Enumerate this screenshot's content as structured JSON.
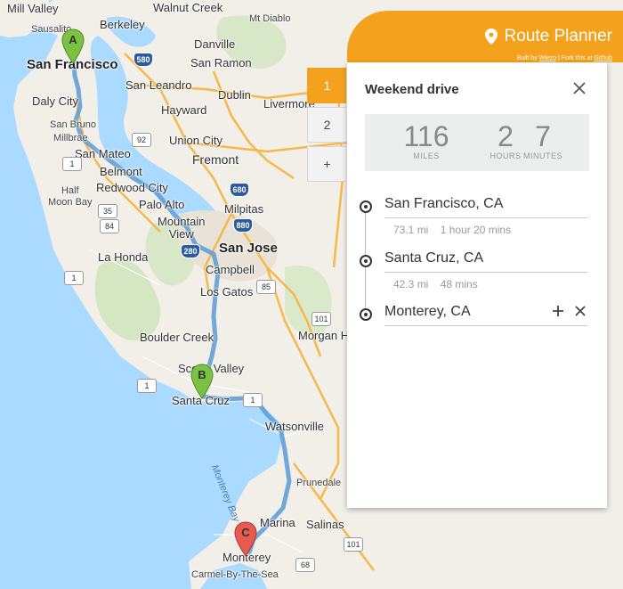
{
  "map": {
    "labels": {
      "mill_valley": "Mill Valley",
      "walnut_creek": "Walnut Creek",
      "mt_diablo": "Mt Diablo",
      "sausalito": "Sausalito",
      "berkeley": "Berkeley",
      "danville": "Danville",
      "san_francisco": "San Francisco",
      "san_ramon": "San Ramon",
      "daly_city": "Daly City",
      "san_leandro": "San Leandro",
      "dublin": "Dublin",
      "hayward": "Hayward",
      "livermore": "Livermore",
      "san_bruno": "San Bruno",
      "millbrae": "Millbrae",
      "union_city": "Union City",
      "san_mateo": "San Mateo",
      "fremont": "Fremont",
      "belmont": "Belmont",
      "redwood_city": "Redwood City",
      "half_moon_bay": "Half\nMoon Bay",
      "palo_alto": "Palo Alto",
      "milpitas": "Milpitas",
      "mountain_view": "Mountain\nView",
      "san_jose": "San Jose",
      "la_honda": "La Honda",
      "campbell": "Campbell",
      "los_gatos": "Los Gatos",
      "boulder_creek": "Boulder Creek",
      "morgan_hill": "Morgan H",
      "scotts_valley": "Scotts Valley",
      "santa_cruz": "Santa Cruz",
      "watsonville": "Watsonville",
      "monterey_bay": "Monterey Bay",
      "prunedale": "Prunedale",
      "marina": "Marina",
      "salinas": "Salinas",
      "monterey": "Monterey",
      "carmel": "Carmel-By-The-Sea"
    },
    "shields": {
      "s580": "580",
      "s92": "92",
      "s680": "680",
      "s880": "880",
      "s280": "280",
      "s35": "35",
      "s84": "84",
      "s1a": "1",
      "s1b": "1",
      "s1c": "1",
      "s1d": "1",
      "s85": "85",
      "s101a": "101",
      "s101b": "101",
      "s68": "68"
    },
    "markers": {
      "a": "A",
      "b": "B",
      "c": "C"
    },
    "colors": {
      "water": "#aadaff",
      "land": "#f2efe9",
      "route": "#5b9bd5",
      "marker_ab": "#7cc242",
      "marker_c": "#e85a4f"
    }
  },
  "header": {
    "title": "Route Planner",
    "subtitle_prefix": "Built by",
    "subtitle_link1": "Wiezo",
    "subtitle_mid": "| Fork this at",
    "subtitle_link2": "Github",
    "accent": "#f4a21d"
  },
  "tabs": [
    "1",
    "2",
    "+"
  ],
  "trip": {
    "title": "Weekend drive",
    "stats": {
      "miles": "116",
      "miles_label": "MILES",
      "hours": "2",
      "hours_label": "HOURS",
      "minutes": "7",
      "minutes_label": "MINUTES"
    },
    "stops": [
      {
        "name": "San Francisco, CA"
      },
      {
        "name": "Santa Cruz, CA"
      },
      {
        "name": "Monterey, CA"
      }
    ],
    "legs": [
      {
        "distance": "73.1 mi",
        "duration": "1 hour 20 mins"
      },
      {
        "distance": "42.3 mi",
        "duration": "48 mins"
      }
    ]
  }
}
